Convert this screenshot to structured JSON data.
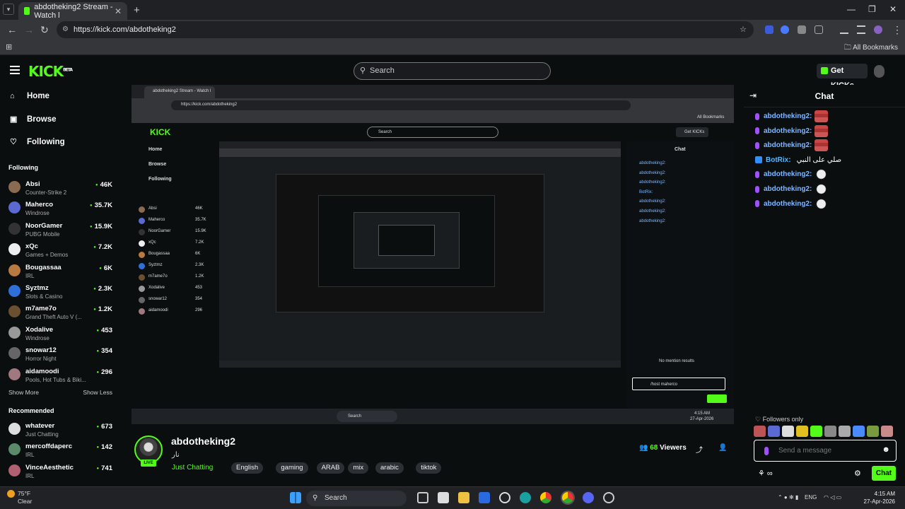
{
  "browser": {
    "tab_title": "abdotheking2 Stream - Watch l",
    "url": "https://kick.com/abdotheking2",
    "all_bookmarks": "All Bookmarks"
  },
  "header": {
    "search_placeholder": "Search",
    "get_kicks": "Get KICKs",
    "logo": "KICK",
    "logo_badge": "BETA"
  },
  "sidebar": {
    "nav": [
      {
        "label": "Home",
        "icon": "home-icon"
      },
      {
        "label": "Browse",
        "icon": "browse-icon"
      },
      {
        "label": "Following",
        "icon": "heart-icon"
      }
    ],
    "following_title": "Following",
    "following": [
      {
        "name": "Absi",
        "category": "Counter-Strike 2",
        "viewers": "46K",
        "color": "#8a6a50"
      },
      {
        "name": "Maherco",
        "category": "Windrose",
        "viewers": "35.7K",
        "color": "#5a6ad0"
      },
      {
        "name": "NoorGamer",
        "category": "PUBG Mobile",
        "viewers": "15.9K",
        "color": "#333"
      },
      {
        "name": "xQc",
        "category": "Games + Demos",
        "viewers": "7.2K",
        "color": "#eee"
      },
      {
        "name": "Bougassaa",
        "category": "IRL",
        "viewers": "6K",
        "color": "#b87a40"
      },
      {
        "name": "Syztmz",
        "category": "Slots & Casino",
        "viewers": "2.3K",
        "color": "#2f6fd8"
      },
      {
        "name": "m7ame7o",
        "category": "Grand Theft Auto V (...",
        "viewers": "1.2K",
        "color": "#6a5030"
      },
      {
        "name": "Xodalive",
        "category": "Windrose",
        "viewers": "453",
        "color": "#999"
      },
      {
        "name": "snowar12",
        "category": "Horror Night",
        "viewers": "354",
        "color": "#666"
      },
      {
        "name": "aidamoodi",
        "category": "Pools, Hot Tubs & Biki...",
        "viewers": "296",
        "color": "#a07880"
      }
    ],
    "show_more": "Show More",
    "show_less": "Show Less",
    "recommended_title": "Recommended",
    "recommended": [
      {
        "name": "whatever",
        "category": "Just Chatting",
        "viewers": "673",
        "color": "#ddd"
      },
      {
        "name": "mercoffdaperc",
        "category": "IRL",
        "viewers": "142",
        "color": "#5a8a6a"
      },
      {
        "name": "VinceAesthetic",
        "category": "IRL",
        "viewers": "741",
        "color": "#b06070"
      }
    ]
  },
  "stream": {
    "streamer": "abdotheking2",
    "title": "نار",
    "category": "Just Chatting",
    "live": "LIVE",
    "tags": [
      "English",
      "gaming",
      "ARAB",
      "mix",
      "arabic",
      "tiktok"
    ],
    "viewers": "68",
    "viewers_label": "Viewers"
  },
  "chat": {
    "title": "Chat",
    "messages": [
      {
        "user": "abdotheking2:",
        "emote": "face"
      },
      {
        "user": "abdotheking2:",
        "emote": "face"
      },
      {
        "user": "abdotheking2:",
        "emote": "face"
      },
      {
        "user": "BotRix:",
        "text": "صلي على النبي",
        "bot": true
      },
      {
        "user": "abdotheking2:",
        "emote": "ghost"
      },
      {
        "user": "abdotheking2:",
        "emote": "ghost"
      },
      {
        "user": "abdotheking2:",
        "emote": "ghost"
      }
    ],
    "followers_only": "Followers only",
    "input_placeholder": "Send a message",
    "send_label": "Chat"
  },
  "nested": {
    "no_mention": "No mention results",
    "host_cmd": "/host maherco",
    "chat_title": "Chat"
  },
  "taskbar": {
    "temp": "75°F",
    "weather": "Clear",
    "search": "Search",
    "lang": "ENG",
    "time": "4:15 AM",
    "date": "27-Apr-2026"
  }
}
